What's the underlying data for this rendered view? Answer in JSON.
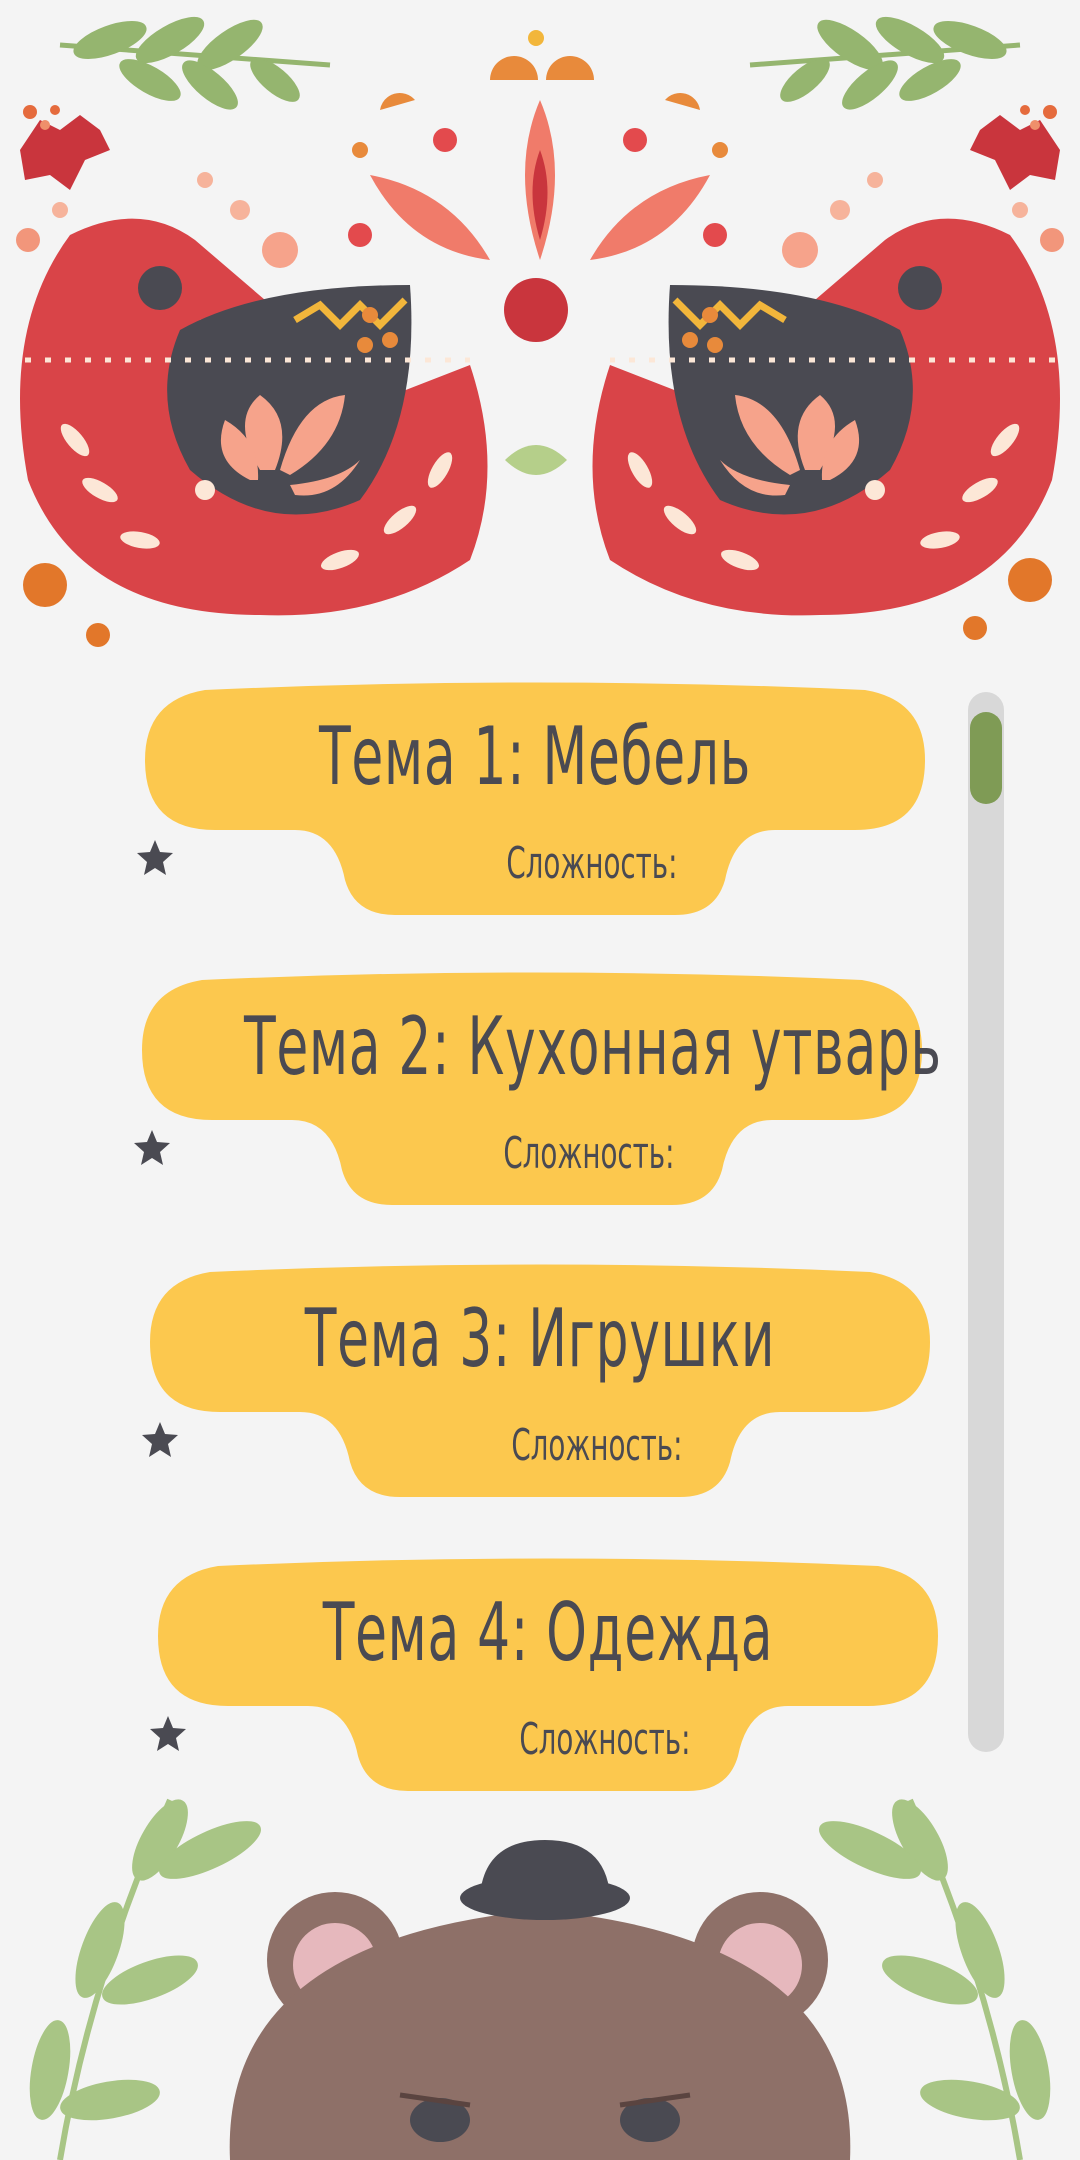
{
  "topics": [
    {
      "title": "Тема 1: Мебель",
      "difficulty_label": "Сложность:",
      "difficulty_stars": 1
    },
    {
      "title": "Тема 2: Кухонная утварь",
      "difficulty_label": "Сложность:",
      "difficulty_stars": 1
    },
    {
      "title": "Тема 3: Игрушки",
      "difficulty_label": "Сложность:",
      "difficulty_stars": 1
    },
    {
      "title": "Тема 4: Одежда",
      "difficulty_label": "Сложность:",
      "difficulty_stars": 1
    }
  ],
  "colors": {
    "background": "#f4f4f4",
    "card": "#fcc84e",
    "text": "#4a4a52",
    "bird": "#d94448",
    "bird_wing": "#4a4a52",
    "leaf": "#95b56f",
    "bear": "#8e7068",
    "scroll_thumb": "#7f9b55",
    "scroll_track": "#d8d8d8"
  },
  "icons": [
    "bird-left-icon",
    "bird-right-icon",
    "flower-icon",
    "leaf-branch-icon",
    "holly-icon",
    "bear-icon",
    "star-icon"
  ]
}
